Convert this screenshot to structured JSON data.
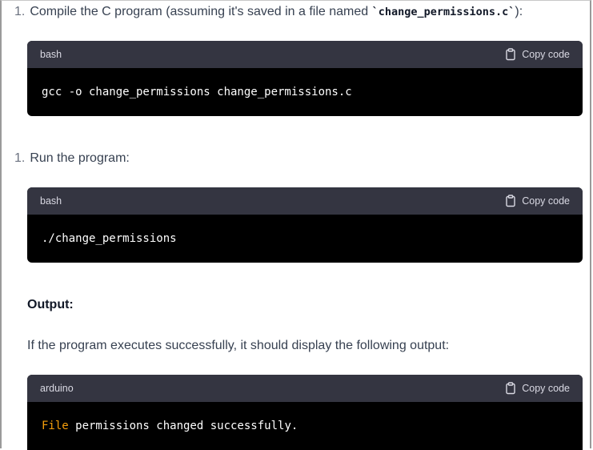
{
  "steps": [
    {
      "number": "1.",
      "text_before": "Compile the C program (assuming it's saved in a file named ",
      "code": "`change_permissions.c`",
      "text_after": "):"
    },
    {
      "number": "1.",
      "text": "Run the program:"
    }
  ],
  "code_blocks": [
    {
      "language": "bash",
      "copy_label": "Copy code",
      "code": "gcc -o change_permissions change_permissions.c"
    },
    {
      "language": "bash",
      "copy_label": "Copy code",
      "code": "./change_permissions"
    },
    {
      "language": "arduino",
      "copy_label": "Copy code",
      "code_keyword": "File",
      "code_rest": " permissions changed successfully."
    }
  ],
  "output_heading": "Output:",
  "output_paragraph": "If the program executes successfully, it should display the following output:",
  "colors": {
    "header_bg": "#343541",
    "code_bg": "#000000",
    "keyword": "#f59e0b",
    "text": "#374151"
  },
  "icons": {
    "copy": "clipboard-icon"
  }
}
